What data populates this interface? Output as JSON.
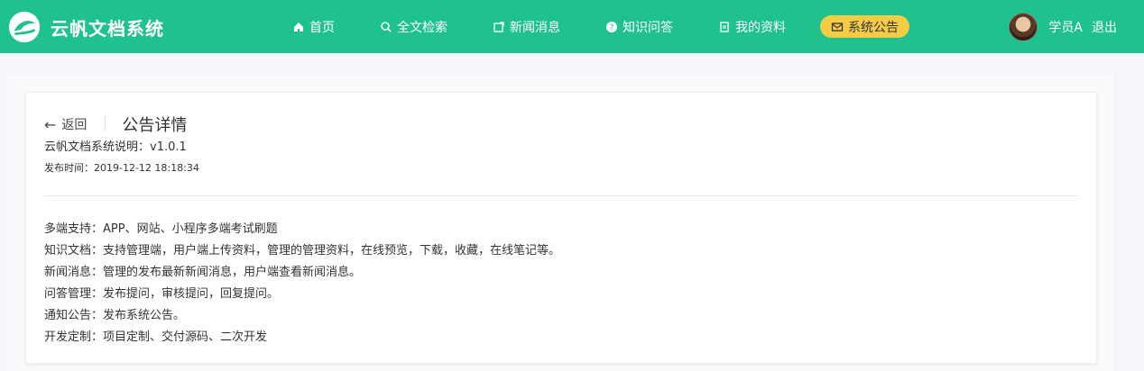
{
  "brand": {
    "name": "云帆文档系统"
  },
  "nav": [
    {
      "label": "首页",
      "icon": "home-icon"
    },
    {
      "label": "全文检索",
      "icon": "search-icon"
    },
    {
      "label": "新闻消息",
      "icon": "news-icon"
    },
    {
      "label": "知识问答",
      "icon": "question-icon"
    },
    {
      "label": "我的资料",
      "icon": "document-icon"
    },
    {
      "label": "系统公告",
      "icon": "mail-icon",
      "active": true
    }
  ],
  "user": {
    "name": "学员A",
    "logout": "退出"
  },
  "detail": {
    "back": "返回",
    "title": "公告详情",
    "doc_title": "云帆文档系统说明：v1.0.1",
    "published": "发布时间：2019-12-12 18:18:34",
    "lines": [
      "多端支持：APP、网站、小程序多端考试刷题",
      "知识文档：支持管理端，用户端上传资料，管理的管理资料，在线预览，下载，收藏，在线笔记等。",
      "新闻消息：管理的发布最新新闻消息，用户端查看新闻消息。",
      "问答管理：发布提问，审核提问，回复提问。",
      "通知公告：发布系统公告。",
      "开发定制：项目定制、交付源码、二次开发"
    ]
  },
  "colors": {
    "primary": "#1fc28f",
    "active_nav": "#f7cc45"
  }
}
